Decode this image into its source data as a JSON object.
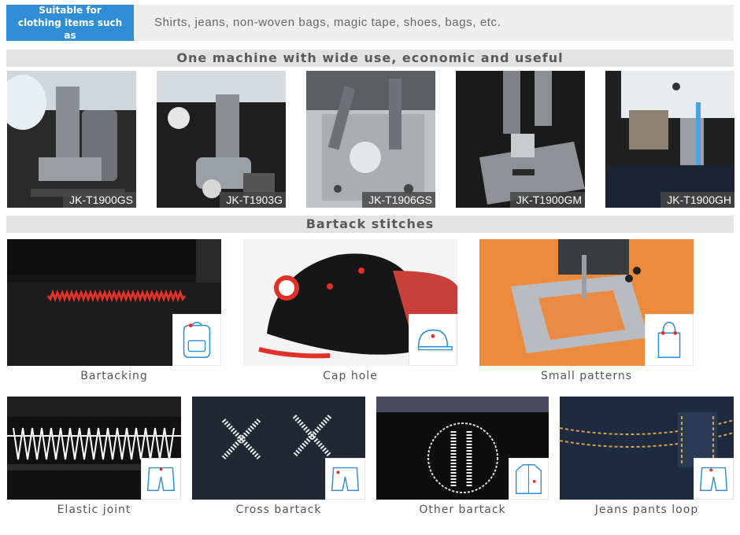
{
  "banner": {
    "badge_text": "Suitable for clothing items such as",
    "description": "Shirts, jeans, non-woven bags, magic tape, shoes, bags, etc."
  },
  "section_machines": {
    "title": "One machine with wide use, economic and useful"
  },
  "machines": [
    {
      "model": "JK-T1900GS"
    },
    {
      "model": "JK-T1903G"
    },
    {
      "model": "JK-T1906GS"
    },
    {
      "model": "JK-T1900GM"
    },
    {
      "model": "JK-T1900GH"
    }
  ],
  "section_stitches": {
    "title": "Bartack stitches"
  },
  "stitches_row1": [
    {
      "caption": "Bartacking",
      "icon": "backpack-icon"
    },
    {
      "caption": "Cap hole",
      "icon": "cap-icon"
    },
    {
      "caption": "Small patterns",
      "icon": "tote-bag-icon"
    }
  ],
  "stitches_row2": [
    {
      "caption": "Elastic joint",
      "icon": "shorts-icon"
    },
    {
      "caption": "Cross bartack",
      "icon": "shorts-icon"
    },
    {
      "caption": "Other bartack",
      "icon": "jacket-icon"
    },
    {
      "caption": "Jeans pants loop",
      "icon": "shorts-icon"
    }
  ],
  "colors": {
    "accent_blue": "#2f8ed6",
    "stitch_red": "#e0302a",
    "icon_line": "#2f8ed6"
  }
}
